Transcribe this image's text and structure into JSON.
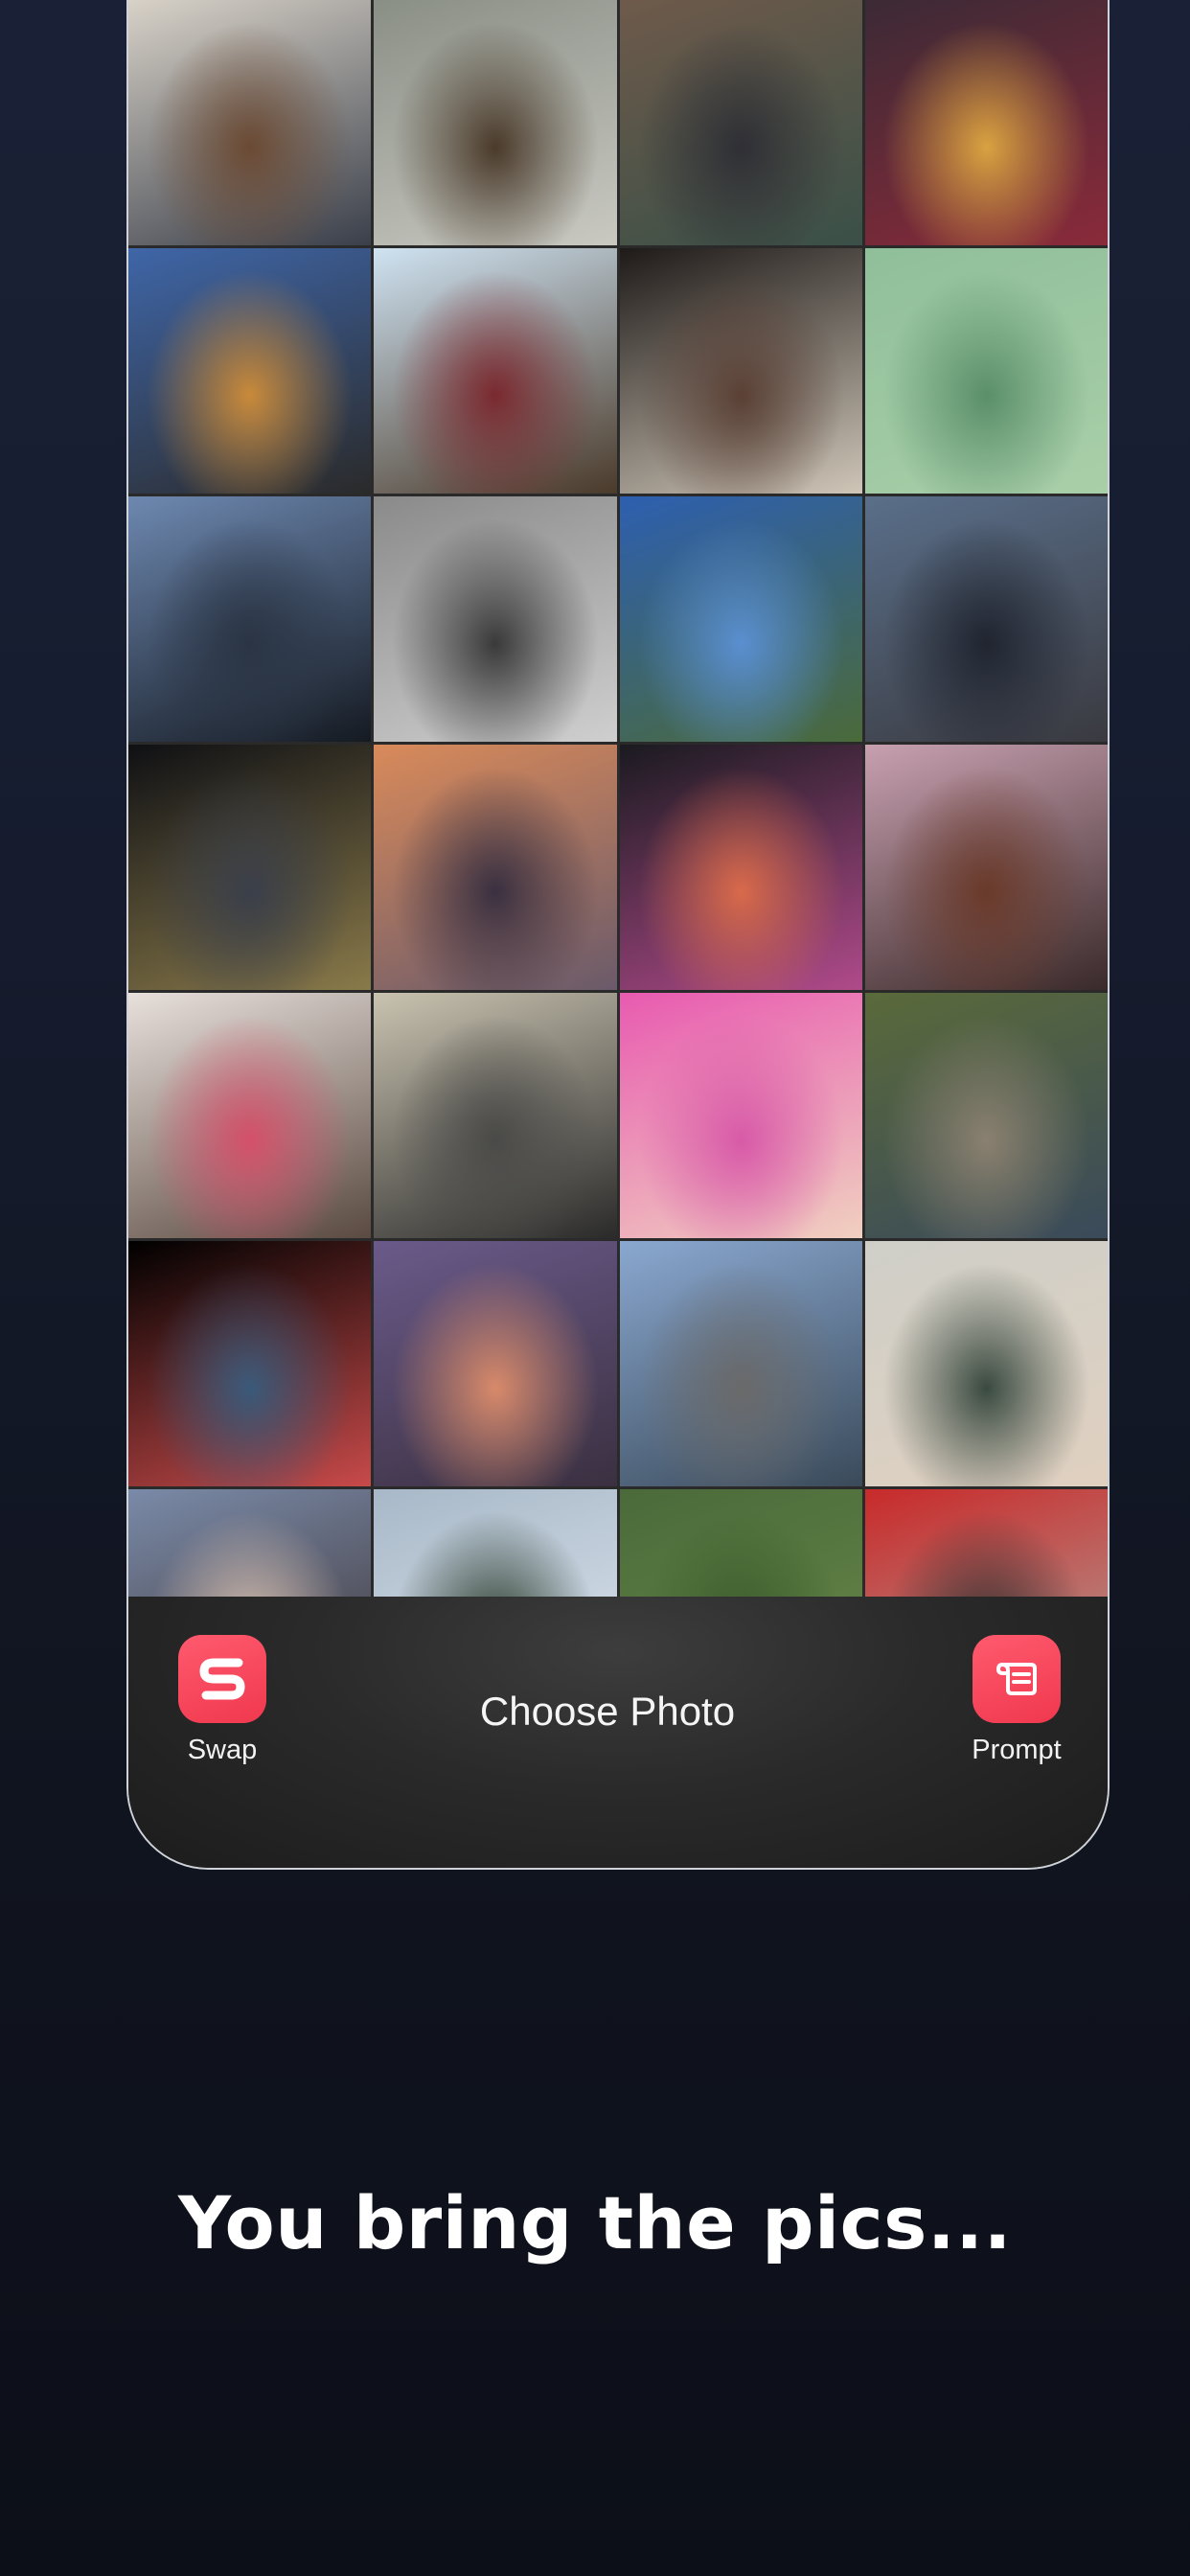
{
  "bottom_bar": {
    "swap_label": "Swap",
    "title": "Choose Photo",
    "prompt_label": "Prompt",
    "swap_icon": "swap-s-icon",
    "prompt_icon": "scroll-icon",
    "accent_color": "#f54359"
  },
  "headline": "You bring the pics...",
  "photos": [
    {
      "name": "photo-kids-guitar",
      "colors": [
        "#d8d2c8",
        "#6b4a33",
        "#3a3f4a"
      ]
    },
    {
      "name": "photo-man-walking-dog",
      "colors": [
        "#8a8f86",
        "#4a3a2a",
        "#c9c9c2"
      ]
    },
    {
      "name": "photo-group-children",
      "colors": [
        "#6e5a4a",
        "#2f2f35",
        "#3a5048"
      ]
    },
    {
      "name": "photo-skull-mask",
      "colors": [
        "#3b2a35",
        "#d9a240",
        "#8a2a3a"
      ]
    },
    {
      "name": "photo-city-river-night",
      "colors": [
        "#3f66a8",
        "#c98a3a",
        "#2a2a2a"
      ]
    },
    {
      "name": "photo-man-selfie",
      "colors": [
        "#cfe3f2",
        "#7a2a30",
        "#4a3a2a"
      ]
    },
    {
      "name": "photo-two-men-selfie",
      "colors": [
        "#1e1a18",
        "#5a4035",
        "#cfc6b8"
      ]
    },
    {
      "name": "photo-green-leaves",
      "colors": [
        "#8fbf9a",
        "#5a8f6a",
        "#a9cfa8"
      ]
    },
    {
      "name": "photo-bridge-dusk",
      "colors": [
        "#6d88b0",
        "#2a3444",
        "#151a22"
      ]
    },
    {
      "name": "photo-gym-barbell",
      "colors": [
        "#8a8a8a",
        "#3a3a3a",
        "#cfcfcf"
      ]
    },
    {
      "name": "photo-coast-view",
      "colors": [
        "#2d5fb0",
        "#5a8fd0",
        "#4a6a3a"
      ]
    },
    {
      "name": "photo-skyline-night",
      "colors": [
        "#5a6f8a",
        "#202530",
        "#3a3a40"
      ]
    },
    {
      "name": "photo-teapot",
      "colors": [
        "#0f1014",
        "#3a3f4a",
        "#8a7a4a"
      ]
    },
    {
      "name": "photo-sunset-beach-person",
      "colors": [
        "#d98a5a",
        "#3a3040",
        "#6a5a6a"
      ]
    },
    {
      "name": "photo-women-night-street",
      "colors": [
        "#1a1a20",
        "#d86a4a",
        "#b04a8a"
      ]
    },
    {
      "name": "photo-group-selfie-party",
      "colors": [
        "#c8a0b0",
        "#6a3a2a",
        "#3a2a2a"
      ]
    },
    {
      "name": "photo-happy-pills-store",
      "colors": [
        "#e8e0dc",
        "#d4506a",
        "#5a4a40"
      ]
    },
    {
      "name": "photo-nasa-plaque",
      "colors": [
        "#c9c3b0",
        "#4a4a48",
        "#2a2a2a"
      ]
    },
    {
      "name": "photo-girl-pink-wig",
      "colors": [
        "#e85ab0",
        "#d85aa8",
        "#f0d0c0"
      ]
    },
    {
      "name": "photo-child-ducks",
      "colors": [
        "#5a6a3a",
        "#8a8070",
        "#3a4a5a"
      ]
    },
    {
      "name": "photo-floral-shoe",
      "colors": [
        "#000000",
        "#3a5a7a",
        "#c84a4a"
      ]
    },
    {
      "name": "photo-sunset-ocean",
      "colors": [
        "#6a5a8a",
        "#d88a6a",
        "#3a3040"
      ]
    },
    {
      "name": "photo-balcony-city",
      "colors": [
        "#8aa8d0",
        "#6a6a6a",
        "#3a4a5a"
      ]
    },
    {
      "name": "photo-woman-laughing",
      "colors": [
        "#cfcfc8",
        "#3a4a40",
        "#e0d0c0"
      ]
    },
    {
      "name": "photo-sky-silhouette",
      "colors": [
        "#7a8aa8",
        "#d8c0b0",
        "#3a3030"
      ]
    },
    {
      "name": "photo-snowy-trees",
      "colors": [
        "#a8b8c8",
        "#2a3a2a",
        "#e0e8f0"
      ]
    },
    {
      "name": "photo-green-park",
      "colors": [
        "#4a6a3a",
        "#3a5a2a",
        "#6a8a4a"
      ]
    },
    {
      "name": "photo-red-kitchen",
      "colors": [
        "#c82a2a",
        "#3a3030",
        "#b0a8a0"
      ]
    }
  ]
}
